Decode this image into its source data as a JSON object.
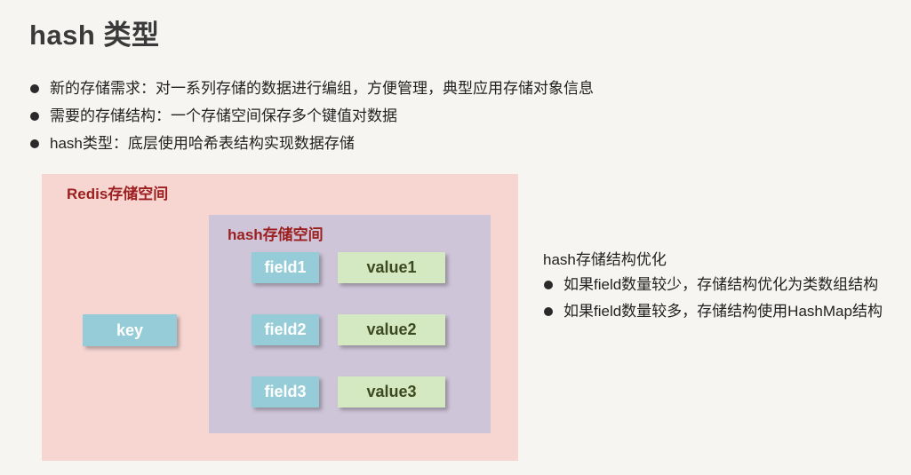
{
  "title": "hash 类型",
  "bullets": [
    "新的存储需求：对一系列存储的数据进行编组，方便管理，典型应用存储对象信息",
    "需要的存储结构：一个存储空间保存多个键值对数据",
    "hash类型：底层使用哈希表结构实现数据存储"
  ],
  "diagram": {
    "redis_label": "Redis存储空间",
    "hash_label": "hash存储空间",
    "key": "key",
    "fields": [
      "field1",
      "field2",
      "field3"
    ],
    "values": [
      "value1",
      "value2",
      "value3"
    ]
  },
  "side": {
    "title": "hash存储结构优化",
    "bullets": [
      "如果field数量较少，存储结构优化为类数组结构",
      "如果field数量较多，存储结构使用HashMap结构"
    ]
  },
  "colors": {
    "redis_space": "#f7d6d2",
    "hash_space": "#cec5d8",
    "key_field_box": "#95ccd7",
    "value_box": "#d4e8c1",
    "label_red": "#9c1f1f"
  }
}
